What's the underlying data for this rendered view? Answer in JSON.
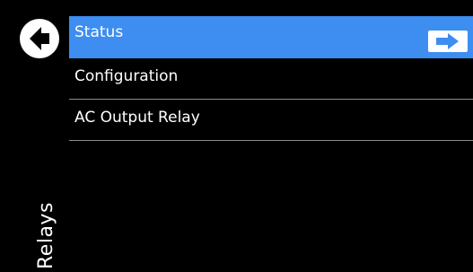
{
  "screen": {
    "title": "Relays"
  },
  "sidebar": {
    "back_icon": "back-arrow-circle-icon"
  },
  "menu": {
    "items": [
      {
        "label": "Status",
        "selected": true,
        "action_icon": "right-arrow-icon"
      },
      {
        "label": "Configuration",
        "selected": false
      },
      {
        "label": "AC Output Relay",
        "selected": false
      }
    ]
  },
  "colors": {
    "background": "#000000",
    "selected": "#3d8ef0",
    "text": "#ffffff",
    "divider": "#8a8a8a"
  }
}
